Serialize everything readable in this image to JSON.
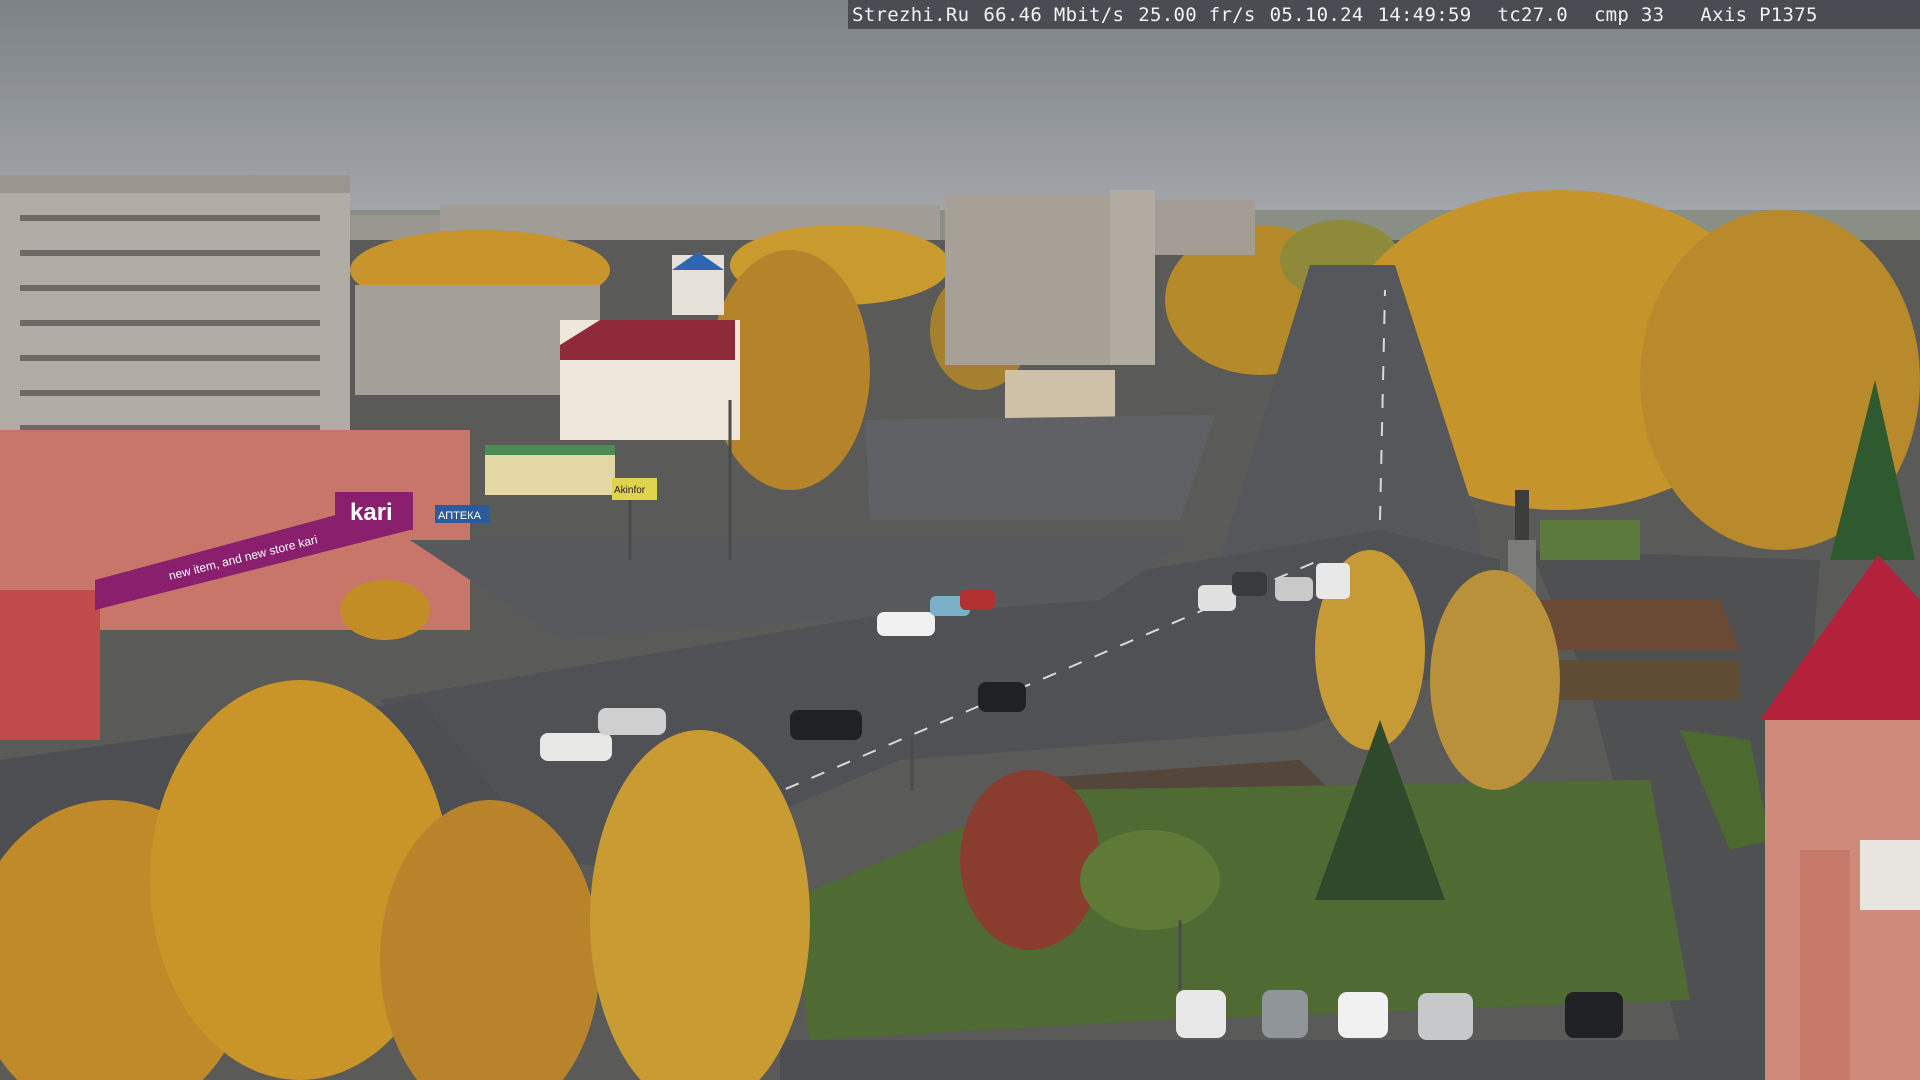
{
  "overlay": {
    "site": "Strezhi.Ru",
    "bitrate": "66.46 Mbit/s",
    "fps": "25.00 fr/s",
    "date": "05.10.24",
    "time": "14:49:59",
    "tc": "tc27.0",
    "cmp": "cmp 33",
    "camera": "Axis P1375"
  },
  "signs": {
    "store": "kari",
    "store_banner": "new item, and new store kari",
    "pharmacy": "АПТЕКА",
    "shop_banner": "Akinfor"
  },
  "colors": {
    "sky": "#8e9398",
    "road": "#56585b",
    "foliage": "#c9962a",
    "grass": "#4f6b33",
    "store_purple": "#8a1f6e",
    "roof_red": "#b4213a"
  }
}
